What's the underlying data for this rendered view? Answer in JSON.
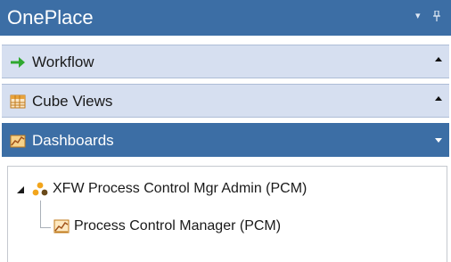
{
  "panel": {
    "title": "OnePlace",
    "title_controls": {
      "dropdown_glyph": "▾",
      "pin_glyph": "ᵖ"
    },
    "colors": {
      "header_blue": "#3c6ea5",
      "section_bg": "#d6dff0",
      "workflow_arrow": "#2fa82f",
      "cube_icon_orange": "#e8a23a",
      "dashboard_icon_orange": "#f0a030",
      "tree_icon_orange": "#f2a51c"
    }
  },
  "sections": [
    {
      "label": "Workflow",
      "icon": "green-arrow-icon",
      "state": "collapsed"
    },
    {
      "label": "Cube Views",
      "icon": "grid-table-icon",
      "state": "collapsed"
    },
    {
      "label": "Dashboards",
      "icon": "chart-icon",
      "state": "expanded"
    }
  ],
  "tree": {
    "root": {
      "label": "XFW Process Control Mgr Admin (PCM)",
      "icon": "cluster-dots-icon",
      "expanded": true,
      "children": [
        {
          "label": "Process Control Manager (PCM)",
          "icon": "dashboard-chart-icon"
        }
      ]
    }
  }
}
